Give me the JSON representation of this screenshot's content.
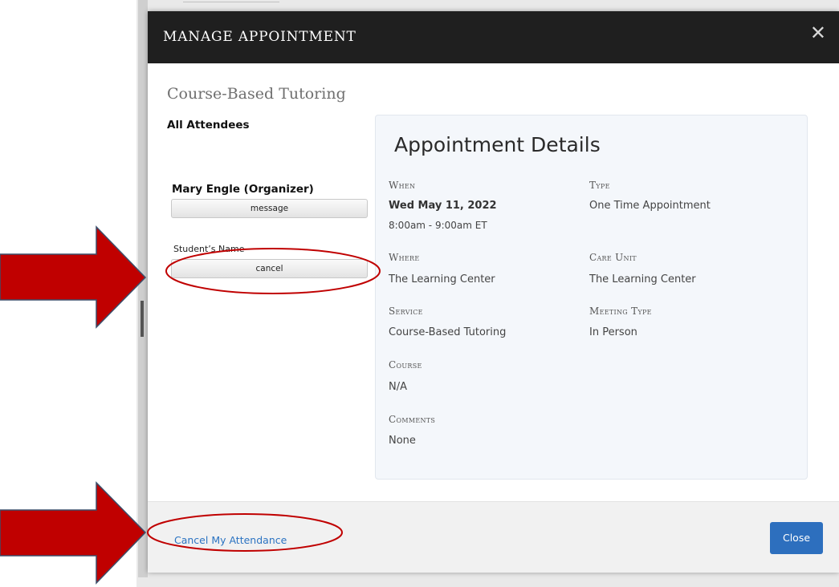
{
  "modal": {
    "title": "MANAGE APPOINTMENT",
    "close_icon": "close-icon",
    "close_glyph": "✕"
  },
  "service_name": "Course-Based Tutoring",
  "attendees": {
    "heading": "All Attendees",
    "organizer": "Mary Engle (Organizer)",
    "message_label": "message",
    "student_name": "Student’s Name",
    "cancel_label": "cancel"
  },
  "details": {
    "title": "Appointment Details",
    "when_label": "When",
    "when_date": "Wed May 11, 2022",
    "when_time": "8:00am - 9:00am ET",
    "type_label": "Type",
    "type_value": "One Time Appointment",
    "where_label": "Where",
    "where_value": "The Learning Center",
    "care_unit_label": "Care Unit",
    "care_unit_value": "The Learning Center",
    "service_label": "Service",
    "service_value": "Course-Based Tutoring",
    "meeting_type_label": "Meeting Type",
    "meeting_type_value": "In Person",
    "course_label": "Course",
    "course_value": "N/A",
    "comments_label": "Comments",
    "comments_value": "None"
  },
  "footer": {
    "cancel_attendance": "Cancel My Attendance",
    "close_label": "Close"
  },
  "colors": {
    "header_bg": "#1f1f1f",
    "link_blue": "#2b73c2",
    "primary_button": "#2d6fbe",
    "arrow_red": "#c00000",
    "highlight_ellipse": "#c00000"
  },
  "annotations": {
    "arrow_icon": "red-arrow-icon",
    "ellipse_icon": "red-highlight-ellipse-icon"
  }
}
